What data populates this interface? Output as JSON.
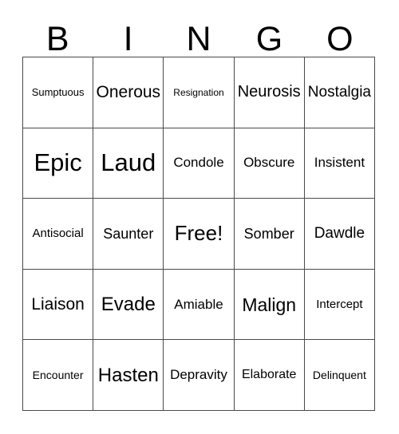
{
  "card": {
    "title": "BINGO",
    "background_color": "#ffffff",
    "text_color": "#000000",
    "border_color": "#4a4a4a"
  },
  "header": {
    "letters": [
      "B",
      "I",
      "N",
      "G",
      "O"
    ]
  },
  "grid": {
    "columns": 5,
    "rows": 5,
    "cells": [
      {
        "text": "Sumptuous",
        "size": 13,
        "free": false
      },
      {
        "text": "Onerous",
        "size": 21,
        "free": false
      },
      {
        "text": "Resignation",
        "size": 12,
        "free": false
      },
      {
        "text": "Neurosis",
        "size": 20,
        "free": false
      },
      {
        "text": "Nostalgia",
        "size": 19,
        "free": false
      },
      {
        "text": "Epic",
        "size": 31,
        "free": false
      },
      {
        "text": "Laud",
        "size": 31,
        "free": false
      },
      {
        "text": "Condole",
        "size": 17,
        "free": false
      },
      {
        "text": "Obscure",
        "size": 17,
        "free": false
      },
      {
        "text": "Insistent",
        "size": 17,
        "free": false
      },
      {
        "text": "Antisocial",
        "size": 15,
        "free": false
      },
      {
        "text": "Saunter",
        "size": 18,
        "free": false
      },
      {
        "text": "Free!",
        "size": 26,
        "free": true
      },
      {
        "text": "Somber",
        "size": 18,
        "free": false
      },
      {
        "text": "Dawdle",
        "size": 19,
        "free": false
      },
      {
        "text": "Liaison",
        "size": 21,
        "free": false
      },
      {
        "text": "Evade",
        "size": 24,
        "free": false
      },
      {
        "text": "Amiable",
        "size": 17,
        "free": false
      },
      {
        "text": "Malign",
        "size": 23,
        "free": false
      },
      {
        "text": "Intercept",
        "size": 15,
        "free": false
      },
      {
        "text": "Encounter",
        "size": 14,
        "free": false
      },
      {
        "text": "Hasten",
        "size": 24,
        "free": false
      },
      {
        "text": "Depravity",
        "size": 17,
        "free": false
      },
      {
        "text": "Elaborate",
        "size": 16,
        "free": false
      },
      {
        "text": "Delinquent",
        "size": 14,
        "free": false
      }
    ]
  }
}
